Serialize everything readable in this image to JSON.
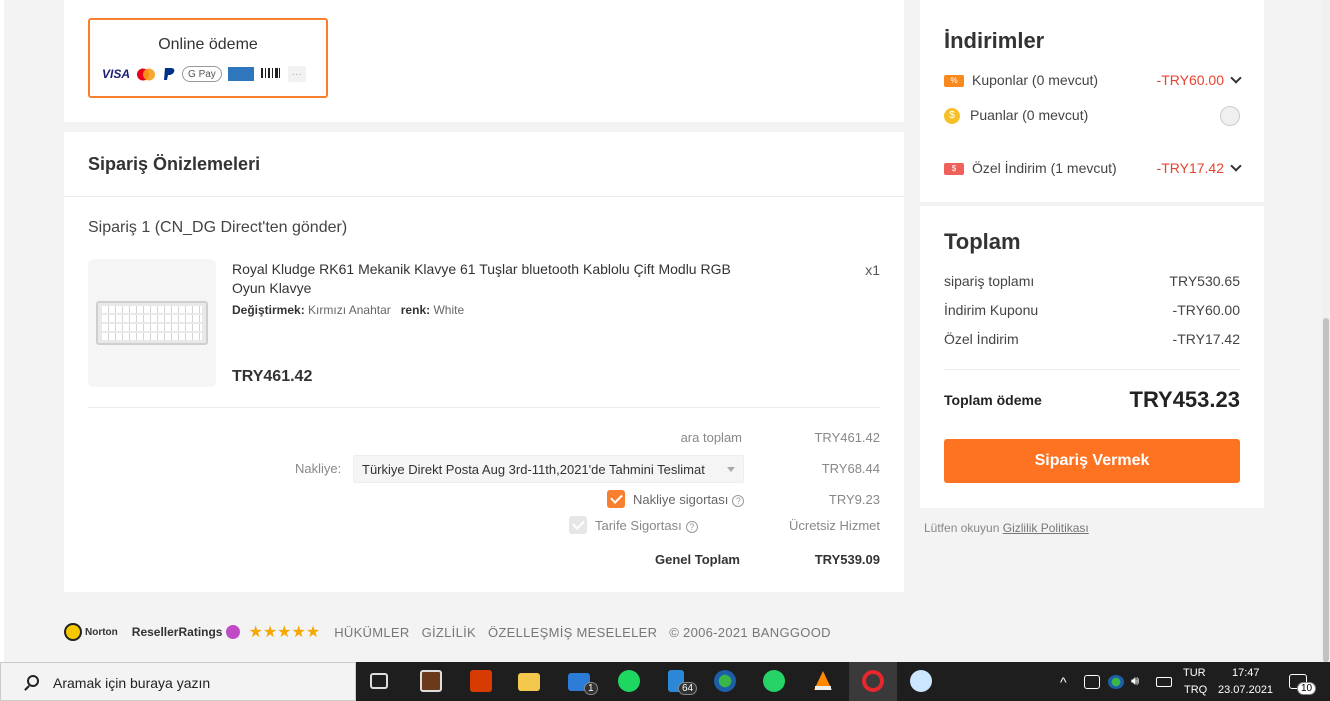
{
  "payment": {
    "title": "Online ödeme",
    "logos": [
      "VISA",
      "mastercard",
      "paypal",
      "G Pay",
      "amex",
      "boleto",
      "..."
    ]
  },
  "preview": {
    "title": "Sipariş Önizlemeleri",
    "order_title": "Sipariş 1 (CN_DG Direct'ten gönder)",
    "product": {
      "name": "Royal Kludge RK61 Mekanik Klavye 61 Tuşlar bluetooth Kablolu Çift Modlu RGB Oyun Klavye",
      "attr1_label": "Değiştirmek:",
      "attr1_value": "Kırmızı Anahtar",
      "attr2_label": "renk:",
      "attr2_value": "White",
      "qty": "x1",
      "price": "TRY461.42"
    },
    "subtotal_label": "ara toplam",
    "subtotal_value": "TRY461.42",
    "shipping_label": "Nakliye:",
    "shipping_option": "Türkiye Direkt Posta Aug 3rd-11th,2021'de Tahmini Teslimat",
    "shipping_value": "TRY68.44",
    "ship_insurance_label": "Nakliye sigortası",
    "ship_insurance_value": "TRY9.23",
    "tariff_insurance_label": "Tarife Sigortası",
    "tariff_insurance_value": "Ücretsiz Hizmet",
    "grand_total_label": "Genel Toplam",
    "grand_total_value": "TRY539.09"
  },
  "discounts": {
    "title": "İndirimler",
    "coupons_label": "Kuponlar (0 mevcut)",
    "coupons_value": "-TRY60.00",
    "points_label": "Puanlar (0 mevcut)",
    "special_label": "Özel İndirim (1 mevcut)",
    "special_value": "-TRY17.42"
  },
  "total": {
    "title": "Toplam",
    "order_total_label": "sipariş toplamı",
    "order_total_value": "TRY530.65",
    "coupon_label": "İndirim Kuponu",
    "coupon_value": "-TRY60.00",
    "special_label": "Özel İndirim",
    "special_value": "-TRY17.42",
    "pay_label": "Toplam ödeme",
    "pay_value": "TRY453.23",
    "order_button": "Sipariş Vermek"
  },
  "privacy": {
    "text": "Lütfen okuyun",
    "link": "Gizlilik Politikası"
  },
  "footer": {
    "norton": "Norton",
    "reseller": "ResellerRatings",
    "stars": "★★★★★",
    "links": [
      "HÜKÜMLER",
      "GİZLİLİK",
      "ÖZELLEŞMİŞ MESELELER"
    ],
    "copyright": "© 2006-2021 BANGGOOD"
  },
  "taskbar": {
    "search_placeholder": "Aramak için buraya yazın",
    "mail_badge": "1",
    "calc_badge": "64",
    "lang1": "TUR",
    "lang2": "TRQ",
    "time": "17:47",
    "date": "23.07.2021",
    "notif_count": "10"
  },
  "colors": {
    "accent": "#fe7321",
    "discount_red": "#e8432f",
    "checkbox_orange": "#f77f2f"
  }
}
